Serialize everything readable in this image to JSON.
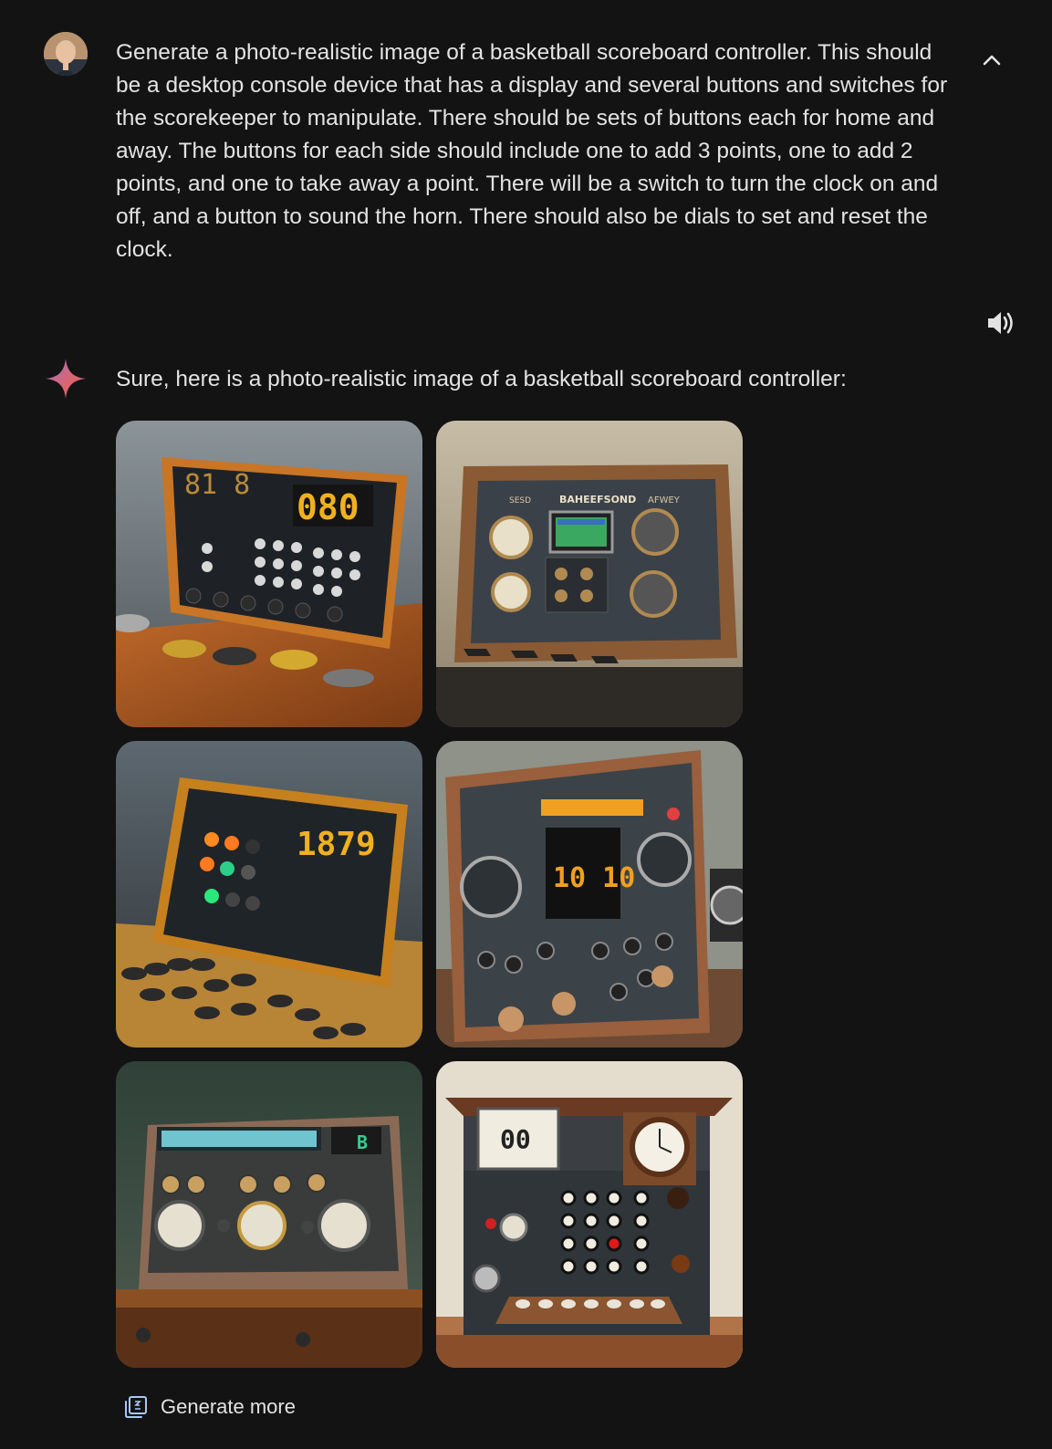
{
  "user_turn": {
    "avatar": "user-avatar",
    "prompt": "Generate a photo-realistic image of a basketball scoreboard controller. This should be a desktop console device that has a display and several buttons and switches for the scorekeeper to manipulate. There should be sets of buttons each for home and away. The buttons for each side should include one to add 3 points, one to add 2 points, and one to take away a point. There will be a switch to turn the clock on and off, and a button to sound the horn. There should also be dials to set and reset the clock.",
    "collapse_icon": "chevron-up-icon"
  },
  "model_turn": {
    "icon": "sparkle-icon",
    "speak_icon": "speaker-icon",
    "response": "Sure, here is a photo-realistic image of a basketball scoreboard controller:",
    "images": [
      {
        "label": "81 8",
        "readout": "080"
      },
      {
        "label": "BAHEEFSOND",
        "left_text": "SESD",
        "right_text": "AFWEY"
      },
      {
        "readout": "1879"
      },
      {
        "readout": "10 10"
      },
      {
        "readout": "B"
      },
      {
        "readout": "00"
      }
    ]
  },
  "actions": {
    "generate_more_label": "Generate more",
    "generate_more_icon": "image-stack-icon"
  },
  "colors": {
    "background": "#131314",
    "text": "#e3e3e3"
  }
}
